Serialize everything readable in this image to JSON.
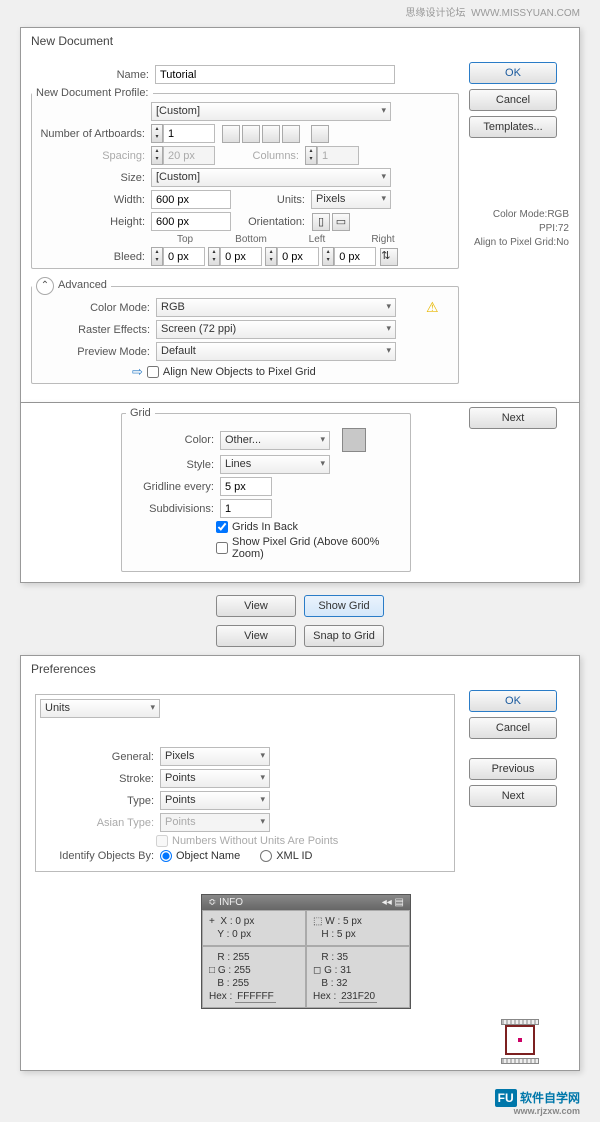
{
  "header": {
    "left": "思缘设计论坛",
    "right": "WWW.MISSYUAN.COM"
  },
  "newdoc": {
    "title": "New Document",
    "name_lbl": "Name:",
    "name_val": "Tutorial",
    "profile_lbl": "New Document Profile:",
    "profile_val": "[Custom]",
    "artboards_lbl": "Number of Artboards:",
    "artboards_val": "1",
    "spacing_lbl": "Spacing:",
    "spacing_val": "20 px",
    "columns_lbl": "Columns:",
    "columns_val": "1",
    "size_lbl": "Size:",
    "size_val": "[Custom]",
    "width_lbl": "Width:",
    "width_val": "600 px",
    "units_lbl": "Units:",
    "units_val": "Pixels",
    "height_lbl": "Height:",
    "height_val": "600 px",
    "orientation_lbl": "Orientation:",
    "bleed_lbl": "Bleed:",
    "bleed": {
      "top_lbl": "Top",
      "bottom_lbl": "Bottom",
      "left_lbl": "Left",
      "right_lbl": "Right",
      "top": "0 px",
      "bottom": "0 px",
      "left": "0 px",
      "right": "0 px"
    },
    "advanced_lbl": "Advanced",
    "colormode_lbl": "Color Mode:",
    "colormode_val": "RGB",
    "raster_lbl": "Raster Effects:",
    "raster_val": "Screen (72 ppi)",
    "preview_lbl": "Preview Mode:",
    "preview_val": "Default",
    "align_lbl": "Align New Objects to Pixel Grid",
    "ok": "OK",
    "cancel": "Cancel",
    "templates": "Templates...",
    "info_cm": "Color Mode:RGB",
    "info_ppi": "PPI:72",
    "info_align": "Align to Pixel Grid:No"
  },
  "grid": {
    "title": "Grid",
    "color_lbl": "Color:",
    "color_val": "Other...",
    "style_lbl": "Style:",
    "style_val": "Lines",
    "every_lbl": "Gridline every:",
    "every_val": "5 px",
    "sub_lbl": "Subdivisions:",
    "sub_val": "1",
    "inback_lbl": "Grids In Back",
    "pixel_lbl": "Show Pixel Grid (Above 600% Zoom)",
    "next": "Next"
  },
  "menu": {
    "view1": "View",
    "showgrid": "Show Grid",
    "view2": "View",
    "snapgrid": "Snap to Grid"
  },
  "prefs": {
    "title": "Preferences",
    "section": "Units",
    "general_lbl": "General:",
    "general_val": "Pixels",
    "stroke_lbl": "Stroke:",
    "stroke_val": "Points",
    "type_lbl": "Type:",
    "type_val": "Points",
    "asian_lbl": "Asian Type:",
    "asian_val": "Points",
    "nwu_lbl": "Numbers Without Units Are Points",
    "identify_lbl": "Identify Objects By:",
    "obj_lbl": "Object Name",
    "xml_lbl": "XML ID",
    "ok": "OK",
    "cancel": "Cancel",
    "previous": "Previous",
    "next": "Next"
  },
  "info": {
    "title": "INFO",
    "x_lbl": "X :",
    "x_val": "0 px",
    "y_lbl": "Y :",
    "y_val": "0 px",
    "w_lbl": "W :",
    "w_val": "5 px",
    "h_lbl": "H :",
    "h_val": "5 px",
    "r1_lbl": "R :",
    "r1_val": "255",
    "g1_lbl": "G :",
    "g1_val": "255",
    "b1_lbl": "B :",
    "b1_val": "255",
    "hex1_lbl": "Hex :",
    "hex1_val": "FFFFFF",
    "r2_lbl": "R :",
    "r2_val": "35",
    "g2_lbl": "G :",
    "g2_val": "31",
    "b2_lbl": "B :",
    "b2_val": "32",
    "hex2_lbl": "Hex :",
    "hex2_val": "231F20"
  },
  "footer": {
    "brand": "软件自学网",
    "url": "www.rjzxw.com"
  }
}
